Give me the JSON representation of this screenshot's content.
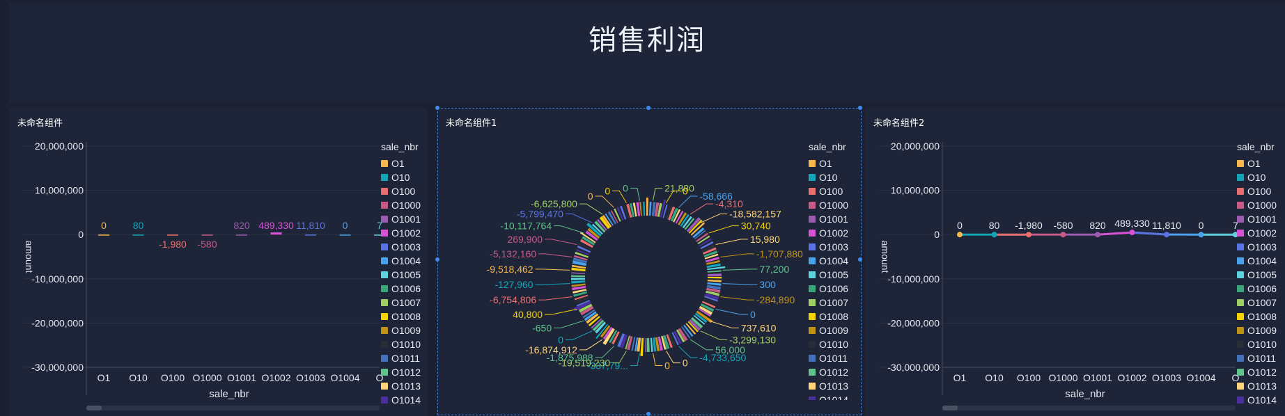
{
  "page": {
    "title": "销售利润"
  },
  "panels": [
    {
      "title": "未命名组件"
    },
    {
      "title": "未命名组件1"
    },
    {
      "title": "未命名组件2"
    }
  ],
  "legend_title": "sale_nbr",
  "legend_items": [
    {
      "name": "O1",
      "color": "#f8b84e"
    },
    {
      "name": "O10",
      "color": "#12a7b8"
    },
    {
      "name": "O100",
      "color": "#ec6f6f"
    },
    {
      "name": "O1000",
      "color": "#c85a85"
    },
    {
      "name": "O1001",
      "color": "#9a5bb0"
    },
    {
      "name": "O1002",
      "color": "#d653d4"
    },
    {
      "name": "O1003",
      "color": "#5b74e3"
    },
    {
      "name": "O1004",
      "color": "#4aa3ee"
    },
    {
      "name": "O1005",
      "color": "#5dd1dd"
    },
    {
      "name": "O1006",
      "color": "#3aa77a"
    },
    {
      "name": "O1007",
      "color": "#9fce63"
    },
    {
      "name": "O1008",
      "color": "#f5d200"
    },
    {
      "name": "O1009",
      "color": "#c09215"
    },
    {
      "name": "O1010",
      "color": "#2a2c36"
    },
    {
      "name": "O1011",
      "color": "#4371ba"
    },
    {
      "name": "O1012",
      "color": "#5fc48b"
    },
    {
      "name": "O1013",
      "color": "#ffd57a"
    },
    {
      "name": "O1014",
      "color": "#4a2fa0"
    }
  ],
  "chart_data": [
    {
      "type": "bar",
      "xlabel": "sale_nbr",
      "ylabel": "amount",
      "ylim": [
        -30000000,
        20000000
      ],
      "yticks": [
        20000000,
        10000000,
        0,
        -10000000,
        -20000000,
        -30000000
      ],
      "ytick_labels": [
        "20,000,000",
        "10,000,000",
        "0",
        "-10,000,000",
        "-20,000,000",
        "-30,000,000"
      ],
      "categories": [
        "O1",
        "O10",
        "O100",
        "O1000",
        "O1001",
        "O1002",
        "O1003",
        "O1004",
        "O"
      ],
      "values": [
        0,
        80,
        -1980,
        -580,
        820,
        489330,
        11810,
        0,
        7
      ],
      "value_labels": [
        "0",
        "80",
        "-1,980",
        "-580",
        "820",
        "489,330",
        "11,810",
        "0",
        "7"
      ],
      "grid": true
    },
    {
      "type": "pie",
      "donut": true,
      "legend_position": "right",
      "labels": [
        {
          "text": "21,880",
          "color": "#9fce63"
        },
        {
          "text": "0",
          "color": "#f5d200"
        },
        {
          "text": "-58,666",
          "color": "#4aa3ee"
        },
        {
          "text": "-4,310",
          "color": "#ec6f6f"
        },
        {
          "text": "-18,582,157",
          "color": "#ffd57a"
        },
        {
          "text": "30,740",
          "color": "#f5d200"
        },
        {
          "text": "15,980",
          "color": "#ffd57a"
        },
        {
          "text": "-1,707,880",
          "color": "#c09215"
        },
        {
          "text": "77,200",
          "color": "#5fc48b"
        },
        {
          "text": "300",
          "color": "#4aa3ee"
        },
        {
          "text": "-284,890",
          "color": "#c09215"
        },
        {
          "text": "0",
          "color": "#4aa3ee"
        },
        {
          "text": "737,610",
          "color": "#ffd57a"
        },
        {
          "text": "-3,299,130",
          "color": "#9fce63"
        },
        {
          "text": "56,000",
          "color": "#5fc48b"
        },
        {
          "text": "-4,733,650",
          "color": "#12a7b8"
        },
        {
          "text": "0",
          "color": "#ffd57a"
        },
        {
          "text": "0",
          "color": "#f8b84e"
        },
        {
          "text": "-337,79...",
          "color": "#12a7b8"
        },
        {
          "text": "-19,519,230",
          "color": "#9fce63"
        },
        {
          "text": "-1,875,988",
          "color": "#5fc48b"
        },
        {
          "text": "-16,874,912",
          "color": "#ffd57a"
        },
        {
          "text": "0",
          "color": "#12a7b8"
        },
        {
          "text": "-650",
          "color": "#5fc48b"
        },
        {
          "text": "40,800",
          "color": "#f5d200"
        },
        {
          "text": "-6,754,806",
          "color": "#ec6f6f"
        },
        {
          "text": "-127,960",
          "color": "#12a7b8"
        },
        {
          "text": "-9,518,462",
          "color": "#f8b84e"
        },
        {
          "text": "-5,132,160",
          "color": "#c85a85"
        },
        {
          "text": "269,900",
          "color": "#c85a85"
        },
        {
          "text": "-10,117,764",
          "color": "#5fc48b"
        },
        {
          "text": "-5,799,470",
          "color": "#5b74e3"
        },
        {
          "text": "-6,625,800",
          "color": "#9fce63"
        },
        {
          "text": "0",
          "color": "#f8b84e"
        },
        {
          "text": "0",
          "color": "#f5d200"
        },
        {
          "text": "0",
          "color": "#5fc48b"
        }
      ]
    },
    {
      "type": "line",
      "xlabel": "sale_nbr",
      "ylabel": "amount",
      "ylim": [
        -30000000,
        20000000
      ],
      "yticks": [
        20000000,
        10000000,
        0,
        -10000000,
        -20000000,
        -30000000
      ],
      "ytick_labels": [
        "20,000,000",
        "10,000,000",
        "0",
        "-10,000,000",
        "-20,000,000",
        "-30,000,000"
      ],
      "categories": [
        "O1",
        "O10",
        "O100",
        "O1000",
        "O1001",
        "O1002",
        "O1003",
        "O1004",
        "O"
      ],
      "values": [
        0,
        80,
        -1980,
        -580,
        820,
        489330,
        11810,
        0,
        7
      ],
      "value_labels": [
        "0",
        "80",
        "-1,980",
        "-580",
        "820",
        "489,330",
        "11,810",
        "0",
        "7"
      ],
      "grid": true
    }
  ]
}
